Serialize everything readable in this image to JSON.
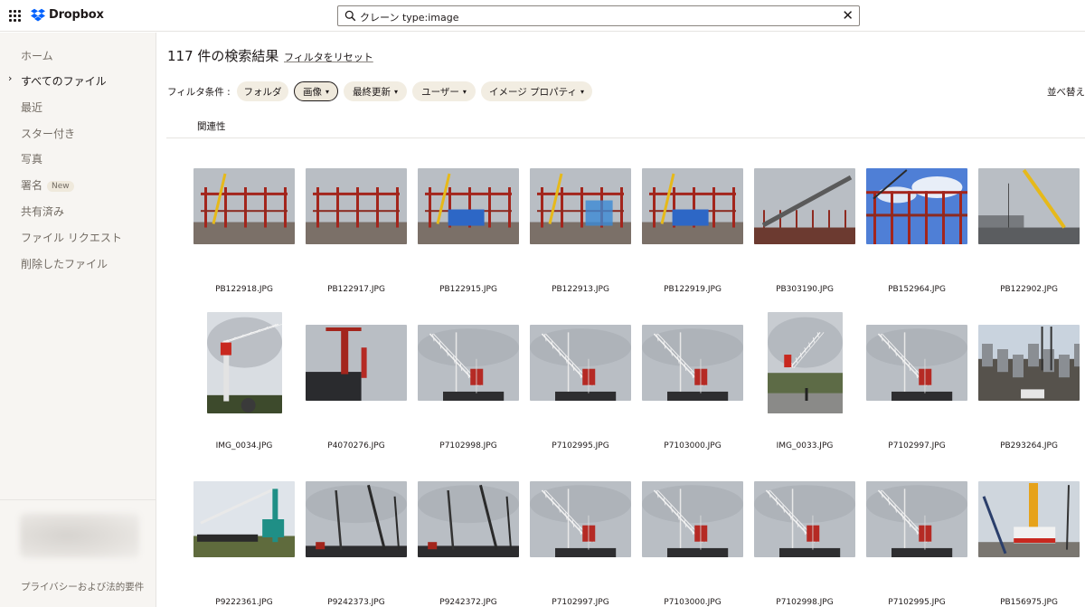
{
  "brand": {
    "name": "Dropbox"
  },
  "search": {
    "query": "クレーン type:image",
    "clear_glyph": "✕"
  },
  "sidebar": {
    "items": [
      {
        "label": "ホーム",
        "active": false
      },
      {
        "label": "すべてのファイル",
        "active": true
      },
      {
        "label": "最近",
        "active": false
      },
      {
        "label": "スター付き",
        "active": false
      },
      {
        "label": "写真",
        "active": false
      },
      {
        "label": "署名",
        "active": false,
        "badge": "New"
      },
      {
        "label": "共有済み",
        "active": false
      },
      {
        "label": "ファイル リクエスト",
        "active": false
      },
      {
        "label": "削除したファイル",
        "active": false
      }
    ],
    "expand_caret": "›",
    "privacy_link": "プライバシーおよび法的要件"
  },
  "main": {
    "results_title": "117 件の検索結果",
    "reset_filters": "フィルタをリセット",
    "filter_label": "フィルタ条件 :",
    "filters": [
      {
        "label": "フォルダ",
        "dropdown": false,
        "selected": false
      },
      {
        "label": "画像",
        "dropdown": true,
        "selected": true
      },
      {
        "label": "最終更新",
        "dropdown": true,
        "selected": false
      },
      {
        "label": "ユーザー",
        "dropdown": true,
        "selected": false
      },
      {
        "label": "イメージ プロパティ",
        "dropdown": true,
        "selected": false
      }
    ],
    "chevron": "⌄",
    "sort_label": "並べ替え",
    "section_tab": "関連性"
  },
  "files": [
    {
      "name": "PB122918.JPG",
      "orientation": "landscape",
      "scene": "site-red-yellow"
    },
    {
      "name": "PB122917.JPG",
      "orientation": "landscape",
      "scene": "site-frame"
    },
    {
      "name": "PB122915.JPG",
      "orientation": "landscape",
      "scene": "site-crane-blue"
    },
    {
      "name": "PB122913.JPG",
      "orientation": "landscape",
      "scene": "site-far"
    },
    {
      "name": "PB122919.JPG",
      "orientation": "landscape",
      "scene": "site-frame-blue"
    },
    {
      "name": "PB303190.JPG",
      "orientation": "landscape",
      "scene": "beam-lift"
    },
    {
      "name": "PB152964.JPG",
      "orientation": "landscape",
      "scene": "blue-sky-frame"
    },
    {
      "name": "PB122902.JPG",
      "orientation": "landscape",
      "scene": "yellow-crane"
    },
    {
      "name": "IMG_0034.JPG",
      "orientation": "portrait",
      "scene": "tower-red-portrait"
    },
    {
      "name": "P4070276.JPG",
      "orientation": "landscape",
      "scene": "red-tower-dark"
    },
    {
      "name": "P7102998.JPG",
      "orientation": "landscape",
      "scene": "tower-grey"
    },
    {
      "name": "P7102995.JPG",
      "orientation": "landscape",
      "scene": "tower-grey"
    },
    {
      "name": "P7103000.JPG",
      "orientation": "landscape",
      "scene": "tower-grey"
    },
    {
      "name": "IMG_0033.JPG",
      "orientation": "portrait",
      "scene": "tower-hill-portrait"
    },
    {
      "name": "P7102997.JPG",
      "orientation": "landscape",
      "scene": "tower-grey"
    },
    {
      "name": "PB293264.JPG",
      "orientation": "landscape",
      "scene": "city-pit"
    },
    {
      "name": "P9222361.JPG",
      "orientation": "landscape",
      "scene": "teal-crawler"
    },
    {
      "name": "P9242373.JPG",
      "orientation": "landscape",
      "scene": "pile-rigs"
    },
    {
      "name": "P9242372.JPG",
      "orientation": "landscape",
      "scene": "pile-rigs"
    },
    {
      "name": "P7102997.JPG",
      "orientation": "landscape",
      "scene": "tower-grey"
    },
    {
      "name": "P7103000.JPG",
      "orientation": "landscape",
      "scene": "tower-grey"
    },
    {
      "name": "P7102998.JPG",
      "orientation": "landscape",
      "scene": "tower-grey"
    },
    {
      "name": "P7102995.JPG",
      "orientation": "landscape",
      "scene": "tower-grey"
    },
    {
      "name": "PB156975.JPG",
      "orientation": "landscape",
      "scene": "truck-crane"
    }
  ],
  "colors": {
    "dropbox_blue": "#0061fe",
    "sidebar_bg": "#f7f5f2",
    "chip_bg": "#f2ede2"
  },
  "icons": {
    "apps": "grid-icon",
    "search": "search-icon",
    "clear": "close-icon",
    "dropdown": "chevron-down-icon"
  }
}
